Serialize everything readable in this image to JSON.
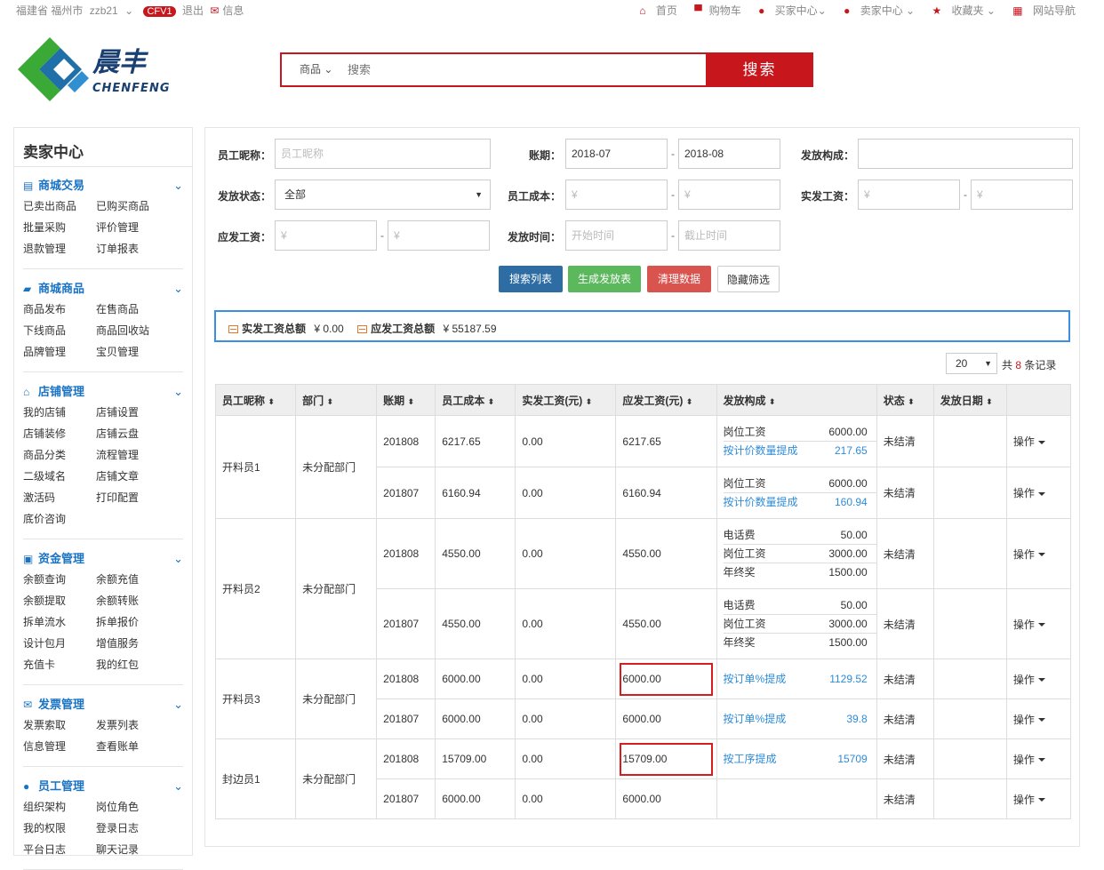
{
  "topbar": {
    "location": "福建省 福州市",
    "user": "zzb21",
    "badge": "CFV1",
    "logout": "退出",
    "messages": "信息",
    "links": [
      "首页",
      "购物车",
      "买家中心",
      "卖家中心",
      "收藏夹",
      "网站导航"
    ]
  },
  "logo": {
    "cn": "晨丰",
    "en": "CHENFENG"
  },
  "search": {
    "category": "商品",
    "placeholder": "搜索",
    "button": "搜索"
  },
  "sidebar": {
    "title": "卖家中心",
    "sections": [
      {
        "title": "商城交易",
        "icon": "credit-card-icon",
        "items": [
          "已卖出商品",
          "已购买商品",
          "批量采购",
          "评价管理",
          "退款管理",
          "订单报表"
        ]
      },
      {
        "title": "商城商品",
        "icon": "truck-icon",
        "items": [
          "商品发布",
          "在售商品",
          "下线商品",
          "商品回收站",
          "品牌管理",
          "宝贝管理"
        ]
      },
      {
        "title": "店铺管理",
        "icon": "home-icon",
        "items": [
          "我的店铺",
          "店铺设置",
          "店铺装修",
          "店铺云盘",
          "商品分类",
          "流程管理",
          "二级域名",
          "店铺文章",
          "激活码",
          "打印配置",
          "底价咨询"
        ]
      },
      {
        "title": "资金管理",
        "icon": "money-icon",
        "items": [
          "余额查询",
          "余额充值",
          "余额提取",
          "余额转账",
          "拆单流水",
          "拆单报价",
          "设计包月",
          "增值服务",
          "充值卡",
          "我的红包"
        ]
      },
      {
        "title": "发票管理",
        "icon": "envelope-icon",
        "items": [
          "发票索取",
          "发票列表",
          "信息管理",
          "查看账单"
        ]
      },
      {
        "title": "员工管理",
        "icon": "users-icon",
        "items": [
          "组织架构",
          "岗位角色",
          "我的权限",
          "登录日志",
          "平台日志",
          "聊天记录"
        ]
      }
    ]
  },
  "filters": {
    "nickname_label": "员工昵称：",
    "nickname_placeholder": "员工昵称",
    "period_label": "账期：",
    "period_from": "2018-07",
    "period_to": "2018-08",
    "composition_label": "发放构成：",
    "status_label": "发放状态：",
    "status_value": "全部",
    "cost_label": "员工成本：",
    "currency": "¥",
    "actual_label": "实发工资：",
    "payable_label": "应发工资：",
    "time_label": "发放时间：",
    "time_from": "开始时间",
    "time_to": "截止时间",
    "dash": "-"
  },
  "buttons": {
    "search": "搜索列表",
    "generate": "生成发放表",
    "clear": "清理数据",
    "hide": "隐藏筛选"
  },
  "summary": {
    "actual_label": "实发工资总额",
    "actual_value": "¥ 0.00",
    "payable_label": "应发工资总额",
    "payable_value": "¥ 55187.59"
  },
  "pager": {
    "page_size": "20",
    "total_prefix": "共",
    "total": "8",
    "total_suffix": "条记录"
  },
  "table": {
    "headers": [
      "员工昵称",
      "部门",
      "账期",
      "员工成本",
      "实发工资(元)",
      "应发工资(元)",
      "发放构成",
      "状态",
      "发放日期",
      ""
    ],
    "op_label": "操作",
    "groups": [
      {
        "name": "开料员1",
        "dept": "未分配部门",
        "rows": [
          {
            "period": "201808",
            "cost": "6217.65",
            "actual": "0.00",
            "payable": "6217.65",
            "status": "未结清",
            "items": [
              {
                "k": "岗位工资",
                "v": "6000.00",
                "link": false
              },
              {
                "k": "按计价数量提成",
                "v": "217.65",
                "link": true
              }
            ]
          },
          {
            "period": "201807",
            "cost": "6160.94",
            "actual": "0.00",
            "payable": "6160.94",
            "status": "未结清",
            "items": [
              {
                "k": "岗位工资",
                "v": "6000.00",
                "link": false
              },
              {
                "k": "按计价数量提成",
                "v": "160.94",
                "link": true
              }
            ]
          }
        ]
      },
      {
        "name": "开料员2",
        "dept": "未分配部门",
        "rows": [
          {
            "period": "201808",
            "cost": "4550.00",
            "actual": "0.00",
            "payable": "4550.00",
            "status": "未结清",
            "items": [
              {
                "k": "电话费",
                "v": "50.00",
                "link": false
              },
              {
                "k": "岗位工资",
                "v": "3000.00",
                "link": false
              },
              {
                "k": "年终奖",
                "v": "1500.00",
                "link": false
              }
            ]
          },
          {
            "period": "201807",
            "cost": "4550.00",
            "actual": "0.00",
            "payable": "4550.00",
            "status": "未结清",
            "items": [
              {
                "k": "电话费",
                "v": "50.00",
                "link": false
              },
              {
                "k": "岗位工资",
                "v": "3000.00",
                "link": false
              },
              {
                "k": "年终奖",
                "v": "1500.00",
                "link": false
              }
            ]
          }
        ]
      },
      {
        "name": "开料员3",
        "dept": "未分配部门",
        "rows": [
          {
            "period": "201808",
            "cost": "6000.00",
            "actual": "0.00",
            "payable": "6000.00",
            "status": "未结清",
            "highlight": true,
            "items": [
              {
                "k": "按订单%提成",
                "v": "1129.52",
                "link": true
              }
            ]
          },
          {
            "period": "201807",
            "cost": "6000.00",
            "actual": "0.00",
            "payable": "6000.00",
            "status": "未结清",
            "items": [
              {
                "k": "按订单%提成",
                "v": "39.8",
                "link": true
              }
            ]
          }
        ]
      },
      {
        "name": "封边员1",
        "dept": "未分配部门",
        "rows": [
          {
            "period": "201808",
            "cost": "15709.00",
            "actual": "0.00",
            "payable": "15709.00",
            "status": "未结清",
            "highlight": true,
            "items": [
              {
                "k": "按工序提成",
                "v": "15709",
                "link": true
              }
            ]
          },
          {
            "period": "201807",
            "cost": "6000.00",
            "actual": "0.00",
            "payable": "6000.00",
            "status": "未结清",
            "items": []
          }
        ]
      }
    ]
  },
  "colors": {
    "brand_red": "#c8161d",
    "link_blue": "#2d8cda",
    "btn_search": "#2e6da4",
    "btn_generate": "#5cb85c",
    "btn_clear": "#d9534f",
    "highlight": "#d61e1e"
  }
}
